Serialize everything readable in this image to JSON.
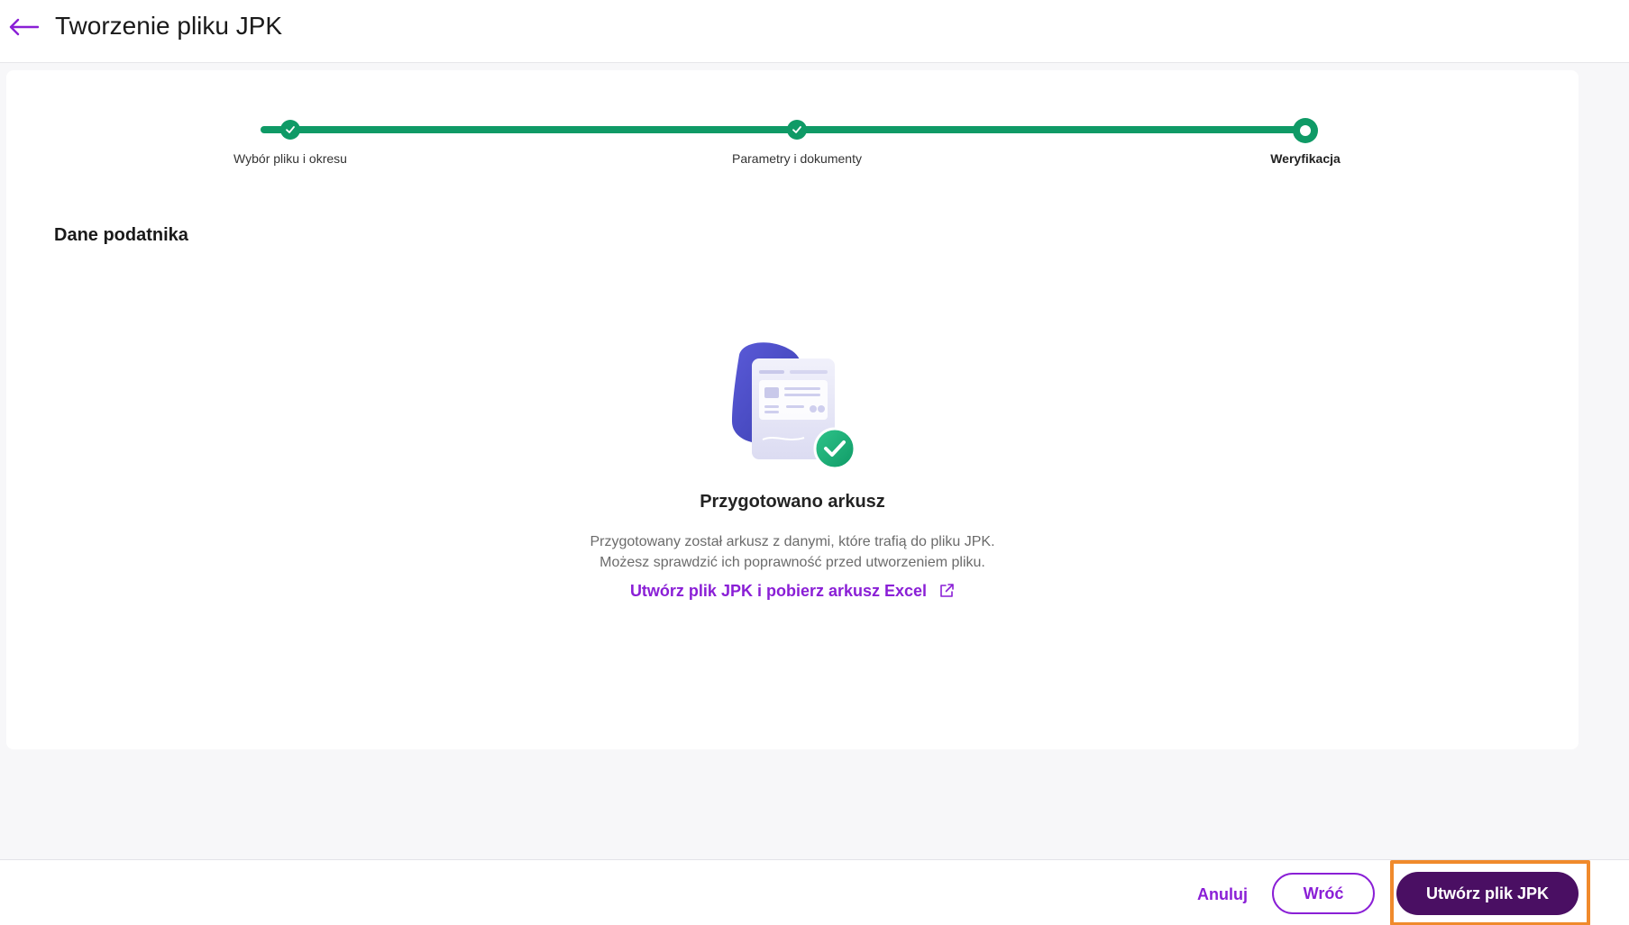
{
  "header": {
    "title": "Tworzenie pliku JPK",
    "back_icon": "arrow-left-icon"
  },
  "stepper": {
    "steps": [
      {
        "label": "Wybór pliku i okresu",
        "status": "done"
      },
      {
        "label": "Parametry i dokumenty",
        "status": "done"
      },
      {
        "label": "Weryfikacja",
        "status": "current"
      }
    ]
  },
  "section": {
    "title": "Dane podatnika"
  },
  "result": {
    "illustration_icon": "document-check-illustration",
    "title": "Przygotowano arkusz",
    "description_line1": "Przygotowany został arkusz z danymi, które trafią do pliku JPK.",
    "description_line2": "Możesz sprawdzić ich poprawność przed utworzeniem pliku.",
    "link_label": "Utwórz plik JPK i pobierz arkusz Excel",
    "link_icon": "external-link-icon"
  },
  "footer": {
    "cancel_label": "Anuluj",
    "back_label": "Wróć",
    "primary_label": "Utwórz plik JPK"
  },
  "colors": {
    "accent": "#8a1fd6",
    "primary_button": "#4a0f63",
    "step_green": "#0f9a66",
    "highlight": "#f08a2c"
  }
}
